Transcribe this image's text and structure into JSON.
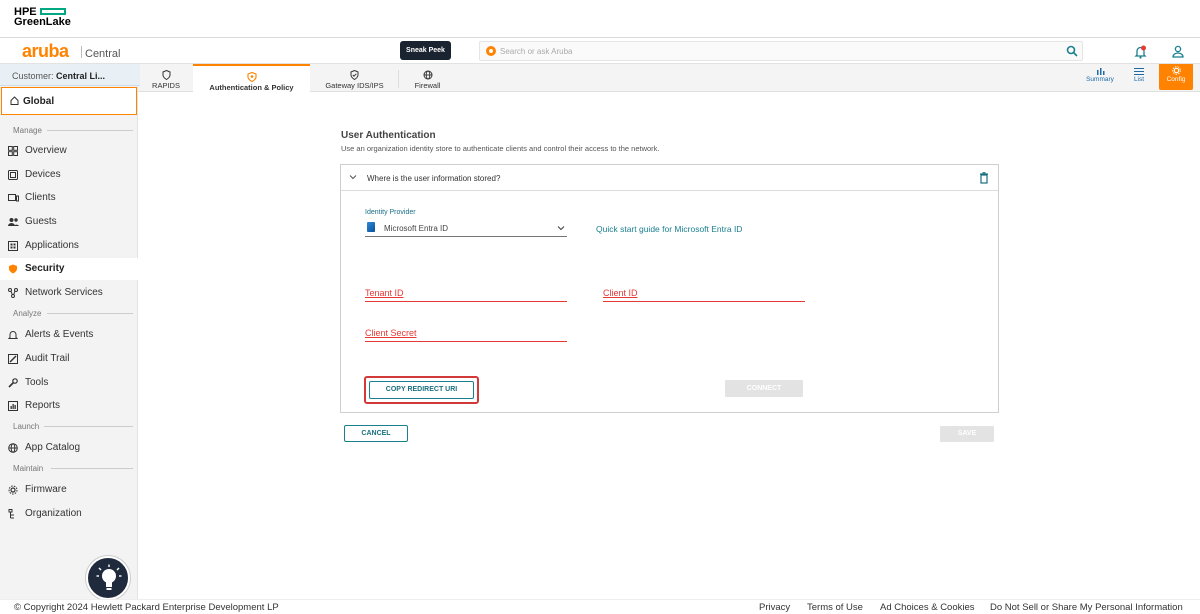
{
  "hpe": {
    "brand_line1": "HPE",
    "brand_line2": "GreenLake"
  },
  "topbar": {
    "logo": "aruba",
    "product": "Central",
    "sneak_peek": "Sneak Peek",
    "search_placeholder": "Search or ask Aruba"
  },
  "customer": {
    "label": "Customer:",
    "name": "Central Li..."
  },
  "tabs": [
    {
      "label": "RAPIDS",
      "icon": "shield-icon"
    },
    {
      "label": "Authentication & Policy",
      "icon": "auth-shield-icon"
    },
    {
      "label": "Gateway IDS/IPS",
      "icon": "shield-check-icon"
    },
    {
      "label": "Firewall",
      "icon": "globe-icon"
    }
  ],
  "views": {
    "summary": "Summary",
    "list": "List",
    "config": "Config"
  },
  "sidebar": {
    "global": "Global",
    "sections": {
      "manage": "Manage",
      "analyze": "Analyze",
      "launch": "Launch",
      "maintain": "Maintain"
    },
    "items": {
      "overview": "Overview",
      "devices": "Devices",
      "clients": "Clients",
      "guests": "Guests",
      "applications": "Applications",
      "security": "Security",
      "network_services": "Network Services",
      "alerts_events": "Alerts & Events",
      "audit_trail": "Audit Trail",
      "tools": "Tools",
      "reports": "Reports",
      "app_catalog": "App Catalog",
      "firmware": "Firmware",
      "organization": "Organization"
    }
  },
  "main": {
    "title": "User Authentication",
    "description": "Use an organization identity store to authenticate clients and control their access to the network.",
    "panel_title": "Where is the user information stored?",
    "idp_label": "Identity Provider",
    "idp_value": "Microsoft Entra ID",
    "quickstart": "Quick start guide for Microsoft Entra ID",
    "tenant_id": "Tenant ID",
    "client_id": "Client ID",
    "client_secret": "Client Secret",
    "copy_redirect": "COPY REDIRECT URI",
    "connect": "CONNECT",
    "cancel": "CANCEL",
    "save": "SAVE"
  },
  "footer": {
    "copyright": "© Copyright 2024 Hewlett Packard Enterprise Development LP",
    "privacy": "Privacy",
    "terms": "Terms of Use",
    "adchoices": "Ad Choices & Cookies",
    "donotsell": "Do Not Sell or Share My Personal Information"
  },
  "colors": {
    "accent": "#ff8300",
    "teal": "#1a7f8f",
    "error": "#e53935",
    "hpe_green": "#01a982"
  }
}
